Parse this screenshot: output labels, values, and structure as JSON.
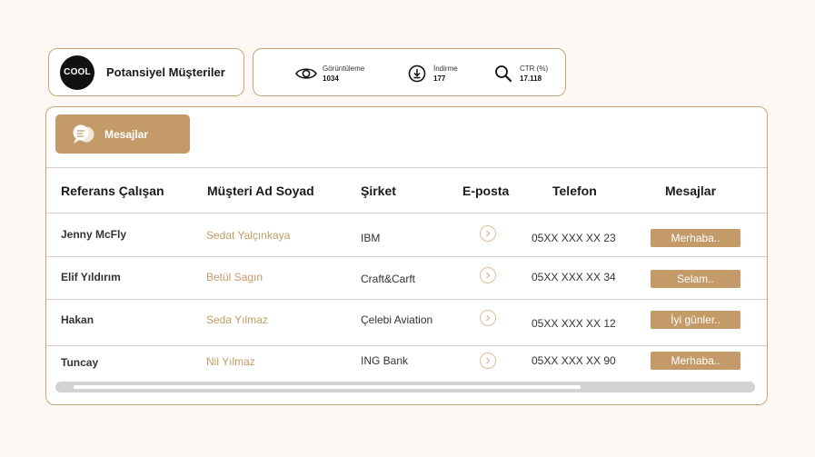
{
  "brand": {
    "logo_text": "COOL",
    "title": "Potansiyel Müşteriler"
  },
  "stats": [
    {
      "icon": "eye-icon",
      "label": "Görüntüleme",
      "value": "1034"
    },
    {
      "icon": "download-icon",
      "label": "İndirme",
      "value": "177"
    },
    {
      "icon": "search-icon",
      "label": "CTR (%)",
      "value": "17.118"
    }
  ],
  "toolbar": {
    "messages_label": "Mesajlar"
  },
  "table": {
    "headers": [
      "Referans Çalışan",
      "Müşteri Ad Soyad",
      "Şirket",
      "E-posta",
      "Telefon",
      "Mesajlar"
    ],
    "rows": [
      {
        "ref": "Jenny McFly",
        "customer": "Sedat Yalçınkaya",
        "company": "IBM",
        "phone": "05XX XXX XX 23",
        "message": "Merhaba.."
      },
      {
        "ref": "Elif Yıldırım",
        "customer": "Betül Sagın",
        "company": "Craft&Carft",
        "phone": "05XX XXX XX 34",
        "message": "Selam.."
      },
      {
        "ref": "Hakan",
        "customer": "Seda Yılmaz",
        "company": "Çelebi Aviation",
        "phone": "05XX XXX XX 12",
        "message": "İyi günler.."
      },
      {
        "ref": "Tuncay",
        "customer": "Nil Yılmaz",
        "company": "ING Bank",
        "phone": "05XX XXX XX 90",
        "message": "Merhaba.."
      }
    ]
  },
  "colors": {
    "accent": "#c49b68",
    "border": "#c9a677",
    "background": "#fdf8f4"
  }
}
